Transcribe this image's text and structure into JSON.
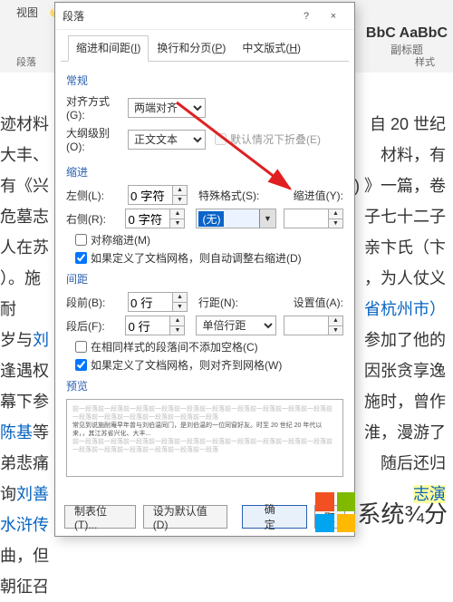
{
  "bg": {
    "ribbon_tab": "视图",
    "style_sample": "BbC AaBbC",
    "style_sub": "副标题",
    "section1": "段落",
    "section2": "样式",
    "doc_lines": [
      "自 20 世纪",
      "材料，有",
      ") 》一篇，卷",
      "子七十二子",
      "亲卞氏（卞",
      "，为人仗义",
      "省杭州市）",
      "参加了他的",
      "因张贪享逸",
      "施时，曾作",
      "淮，漫游了",
      "随后还归",
      "志演",
      ""
    ],
    "left_frag_words": [
      "迹材料",
      "大丰、",
      "有《兴",
      "危墓志",
      "人在苏",
      "）。施耐",
      "岁与刘",
      "逢遇权",
      "幕下参",
      "陈基等",
      "弟悲痛",
      "询刘善",
      "水浒传",
      "曲，但",
      "朝征召"
    ]
  },
  "dialog": {
    "title": "段落",
    "help": "?",
    "close": "×",
    "tabs": {
      "t1_p": "缩进和间距(",
      "t1_u": "I",
      "t1_s": ")",
      "t2_p": "换行和分页(",
      "t2_u": "P",
      "t2_s": ")",
      "t3_p": "中文版式(",
      "t3_u": "H",
      "t3_s": ")"
    },
    "sec_general": "常规",
    "align_label": "对齐方式(G):",
    "align_value": "两端对齐",
    "outline_label": "大纲级别(O):",
    "outline_value": "正文文本",
    "collapse_label": "默认情况下折叠(E)",
    "sec_indent": "缩进",
    "left_label": "左侧(L):",
    "left_value": "0 字符",
    "right_label": "右侧(R):",
    "right_value": "0 字符",
    "special_label": "特殊格式(S):",
    "special_value": "(无)",
    "indent_by_label": "缩进值(Y):",
    "indent_by_value": "",
    "mirror_label": "对称缩进(M)",
    "autoindent_label": "如果定义了文档网格，则自动调整右缩进(D)",
    "sec_spacing": "间距",
    "before_label": "段前(B):",
    "before_value": "0 行",
    "after_label": "段后(F):",
    "after_value": "0 行",
    "linespacing_label": "行距(N):",
    "linespacing_value": "单倍行距",
    "setat_label": "设置值(A):",
    "setat_value": "",
    "nospace_label": "在相同样式的段落间不添加空格(C)",
    "snap_label": "如果定义了文档网格，则对齐到网格(W)",
    "sec_preview": "预览",
    "preview_dummy_light": "前一段落前一段落前一段落前一段落前一段落前一段落前一段落前一段落前一段落前一段落前一段落前一段落前一段落前一段落前一段落前一段落",
    "preview_dummy_dark": "常见到说施耐庵早年曾与刘伯温同门，是刘伯温的一位同窗好友。时至 20 世纪 20 年代以来，，其江苏省兴化、大丰...",
    "btn_tabs": "制表位(T)...",
    "btn_default": "设为默认值(D)",
    "btn_ok": "确定",
    "btn_cancel": "取"
  },
  "logo_text": "系统¾分"
}
